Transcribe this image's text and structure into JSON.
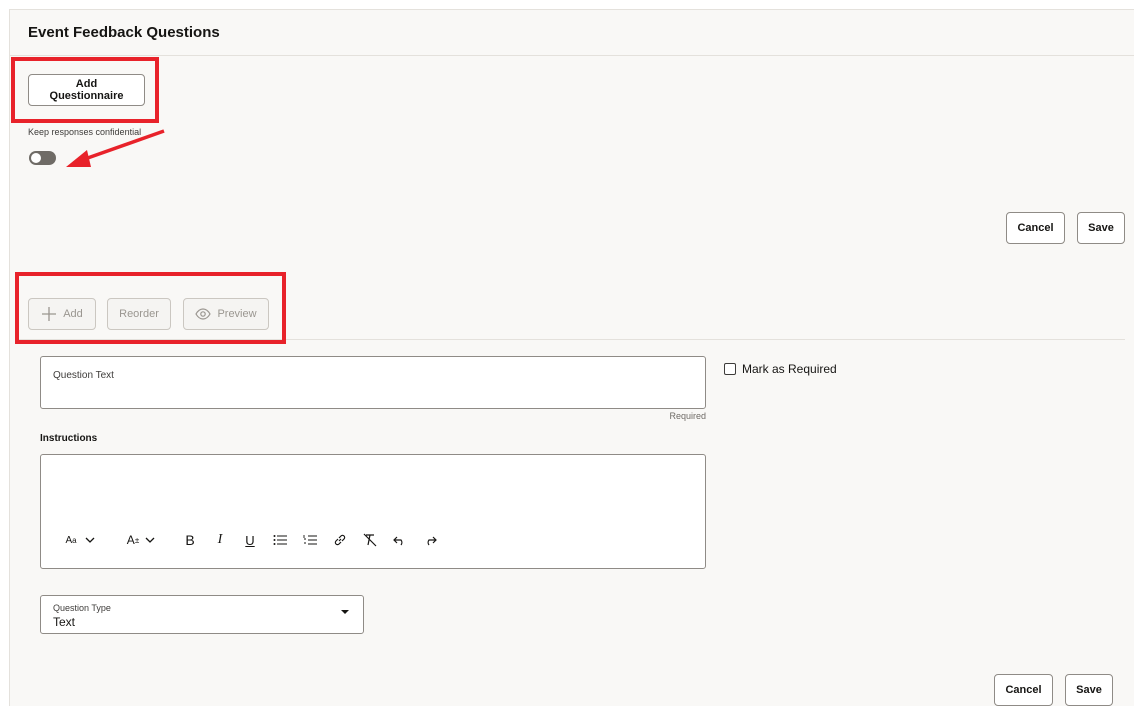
{
  "header": {
    "title": "Event Feedback Questions"
  },
  "actions": {
    "add_questionnaire": "Add Questionnaire"
  },
  "confidential": {
    "label": "Keep responses confidential",
    "enabled": false
  },
  "form_actions": {
    "cancel": "Cancel",
    "save": "Save"
  },
  "toolbar": {
    "add": "Add",
    "reorder": "Reorder",
    "preview": "Preview"
  },
  "question": {
    "text_label": "Question Text",
    "text_value": "",
    "required_note": "Required",
    "mark_required": "Mark as Required",
    "mark_required_checked": false
  },
  "instructions": {
    "label": "Instructions",
    "value": "",
    "tools": [
      {
        "name": "font-size-icon",
        "glyph": "Aa"
      },
      {
        "name": "text-size-icon",
        "glyph": "A±"
      },
      {
        "name": "bold-icon",
        "glyph": "B"
      },
      {
        "name": "italic-icon",
        "glyph": "I"
      },
      {
        "name": "underline-icon",
        "glyph": "U"
      },
      {
        "name": "bullet-list-icon"
      },
      {
        "name": "numbered-list-icon"
      },
      {
        "name": "link-icon"
      },
      {
        "name": "clear-format-icon"
      },
      {
        "name": "undo-icon"
      },
      {
        "name": "redo-icon"
      }
    ]
  },
  "question_type": {
    "label": "Question Type",
    "value": "Text"
  },
  "bottom_actions": {
    "cancel": "Cancel",
    "save": "Save"
  },
  "colors": {
    "annotation": "#e8222a",
    "background": "#f9f8f6",
    "border": "#8f8b86"
  }
}
